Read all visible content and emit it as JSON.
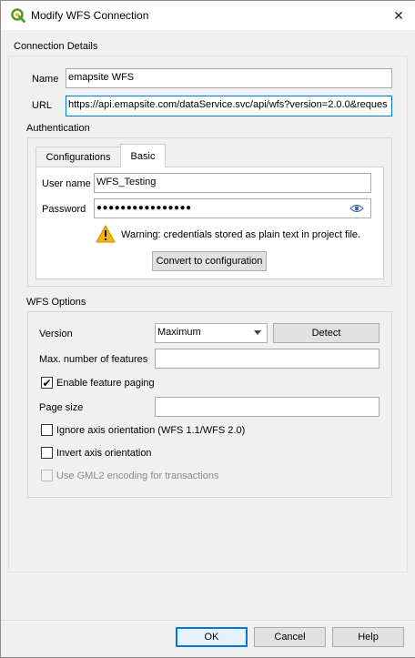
{
  "window": {
    "title": "Modify WFS Connection",
    "logo_icon": "qgis-logo-icon",
    "close_icon": "✕"
  },
  "connection": {
    "section": "Connection Details",
    "name_label": "Name",
    "name_value": "emapsite WFS",
    "url_label": "URL",
    "url_value": "https://api.emapsite.com/dataService.svc/api/wfs?version=2.0.0&reques"
  },
  "auth": {
    "section": "Authentication",
    "tabs": [
      {
        "label": "Configurations"
      },
      {
        "label": "Basic"
      }
    ],
    "active_tab": "Basic",
    "user_label": "User name",
    "user_value": "WFS_Testing",
    "password_label": "Password",
    "password_value": "●●●●●●●●●●●●●●●●",
    "warning": "Warning: credentials stored as plain text in project file.",
    "convert_button": "Convert to configuration"
  },
  "wfs": {
    "section": "WFS Options",
    "version_label": "Version",
    "version_value": "Maximum",
    "detect_button": "Detect",
    "max_features_label": "Max. number of features",
    "max_features_value": "",
    "paging_label": "Enable feature paging",
    "paging_checked": true,
    "page_size_label": "Page size",
    "page_size_value": "",
    "ignore_axis_label": "Ignore axis orientation (WFS 1.1/WFS 2.0)",
    "invert_axis_label": "Invert axis orientation",
    "gml2_label": "Use GML2 encoding for transactions"
  },
  "buttons": {
    "ok": "OK",
    "cancel": "Cancel",
    "help": "Help"
  },
  "colors": {
    "accent": "#0078d7",
    "warning": "#f6b700",
    "logo": "#589632"
  }
}
